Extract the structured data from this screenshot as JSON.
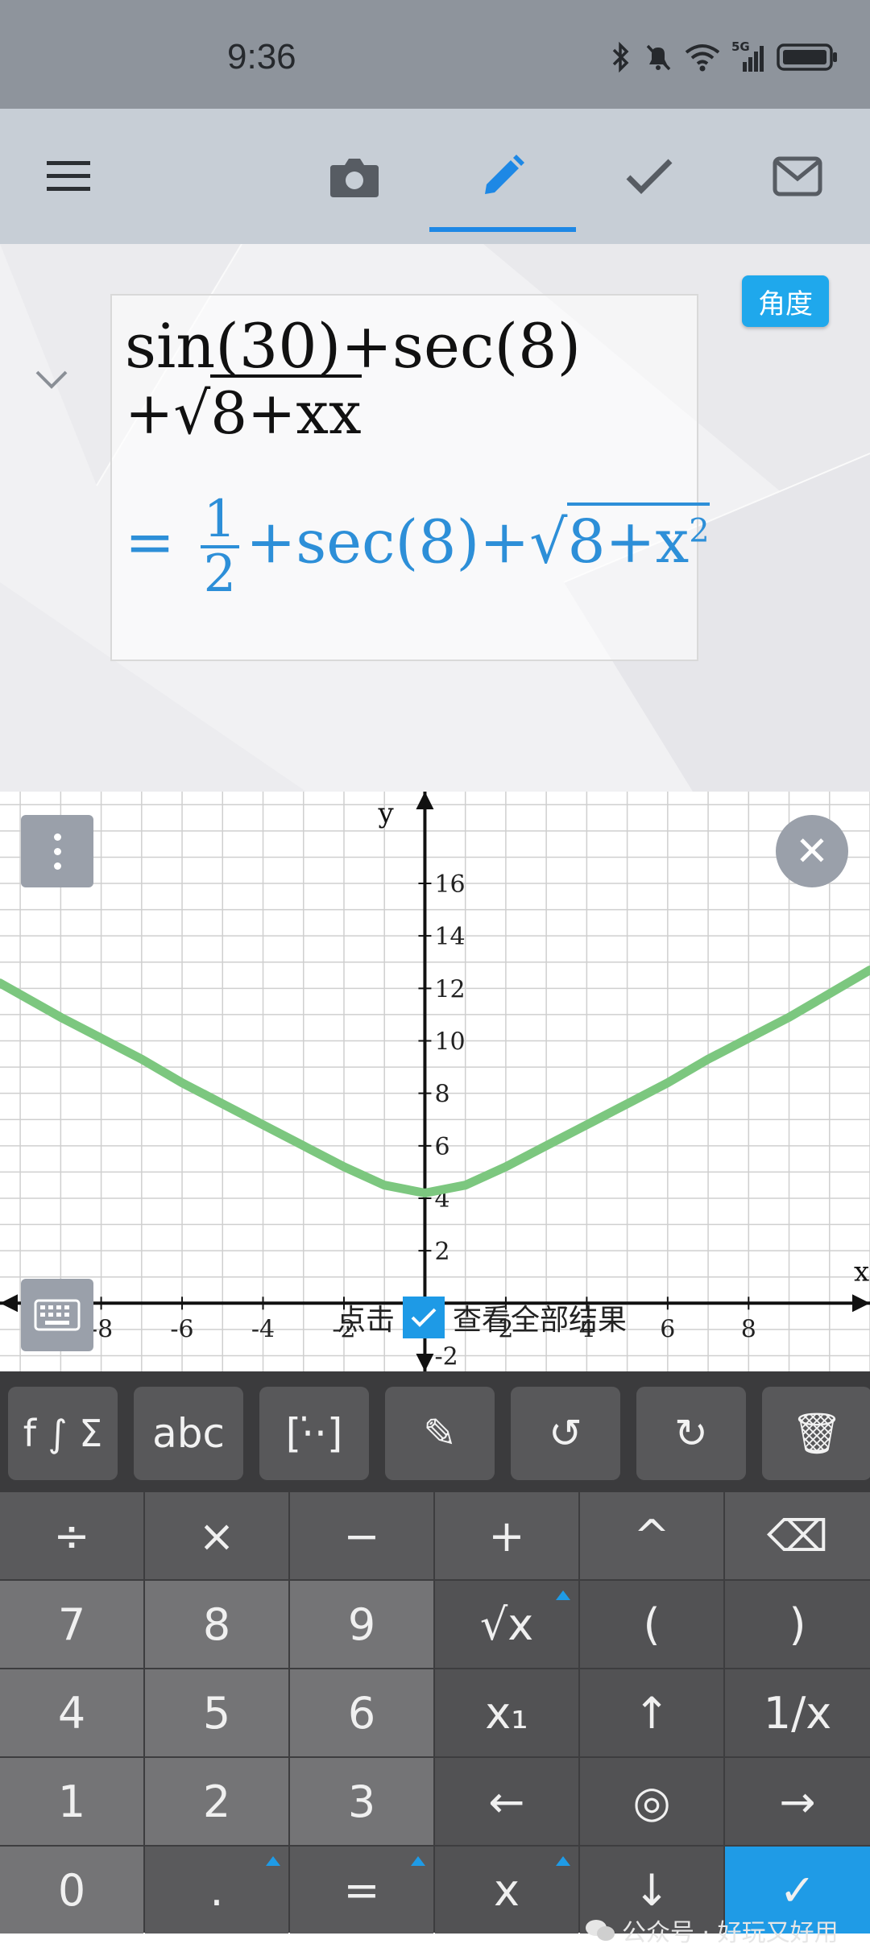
{
  "status_bar": {
    "time": "9:36",
    "network": "5G"
  },
  "toolbar": {
    "menu_icon": "hamburger-menu-icon",
    "tabs": [
      {
        "icon": "camera-icon",
        "active": false
      },
      {
        "icon": "pencil-icon",
        "active": true
      },
      {
        "icon": "checkmark-icon",
        "active": false
      },
      {
        "icon": "mail-icon",
        "active": false
      }
    ]
  },
  "math": {
    "input_line1": "sin(30)+sec(8)",
    "input_line2_prefix": "+√",
    "input_line2_radicand": "8+xx",
    "result_eq": "=",
    "result_frac_num": "1",
    "result_frac_den": "2",
    "result_mid": "+sec(8)+√",
    "result_radicand": "8+x",
    "result_exp": "2",
    "angle_mode": "角度"
  },
  "graph": {
    "x_label": "x",
    "y_label": "y",
    "hint_left": "点击",
    "hint_right": "查看全部结果",
    "curve_color": "#7cc77f"
  },
  "chart_data": {
    "type": "line",
    "xlabel": "x",
    "ylabel": "y",
    "xlim": [
      -10.5,
      11
    ],
    "ylim": [
      -2.6,
      19.5
    ],
    "x_ticks": [
      "-8",
      "-6",
      "-4",
      "-2",
      "2",
      "4",
      "6",
      "8"
    ],
    "y_ticks": [
      "2",
      "4",
      "6",
      "8",
      "10",
      "12",
      "14",
      "16",
      "-2"
    ],
    "series": [
      {
        "x": [
          -10.5,
          -9,
          -8,
          -7,
          -6,
          -5,
          -4,
          -3,
          -2,
          -1,
          0,
          1,
          2,
          3,
          4,
          5,
          6,
          7,
          8,
          9,
          10,
          11
        ],
        "y": [
          12.2,
          10.9,
          10.1,
          9.3,
          8.4,
          7.6,
          6.8,
          6.0,
          5.2,
          4.5,
          4.2,
          4.5,
          5.2,
          6.0,
          6.8,
          7.6,
          8.4,
          9.3,
          10.1,
          10.9,
          11.8,
          12.7
        ]
      }
    ],
    "grid": true
  },
  "function_keys": [
    {
      "label": "f ∫ Σ"
    },
    {
      "label": "abc"
    },
    {
      "label": "[⋅̇⋅]"
    },
    {
      "label": "✎",
      "icon": "pen-settings-icon"
    },
    {
      "label": "↺",
      "icon": "undo-icon"
    },
    {
      "label": "↻",
      "icon": "redo-icon"
    },
    {
      "label": "🗑",
      "icon": "trash-icon"
    }
  ],
  "keys": {
    "row1": [
      "÷",
      "×",
      "−",
      "+",
      "^",
      "⌫"
    ],
    "row2": [
      "7",
      "8",
      "9",
      "√x",
      "(",
      ")"
    ],
    "row3": [
      "4",
      "5",
      "6",
      "x₁",
      "↑",
      "1/x"
    ],
    "row4": [
      "1",
      "2",
      "3",
      "←",
      "◎",
      "→"
    ],
    "row5": [
      "0",
      ".",
      "=",
      "x",
      "↓",
      "✓"
    ]
  },
  "watermark": "公众号 · 好玩又好用"
}
